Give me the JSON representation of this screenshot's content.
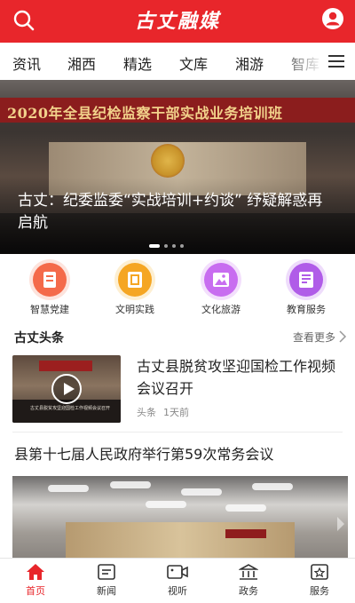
{
  "header": {
    "logo_text": "古丈融媒",
    "search_icon": "search-icon",
    "user_icon": "user-icon"
  },
  "category_nav": {
    "items": [
      "资讯",
      "湘西",
      "精选",
      "文库",
      "湘游",
      "智库"
    ],
    "menu_icon": "menu-icon"
  },
  "banner": {
    "stage_text": "2020年全县纪检监察干部实战业务培训班",
    "title": "古丈：纪委监委“实战培训+约谈” 纾疑解惑再启航"
  },
  "services": [
    {
      "label": "智慧党建",
      "icon": "party-building-icon",
      "color": "#f46a4a"
    },
    {
      "label": "文明实践",
      "icon": "civilization-practice-icon",
      "color": "#f5a623"
    },
    {
      "label": "文化旅游",
      "icon": "culture-tourism-icon",
      "color": "#c86df0"
    },
    {
      "label": "教育服务",
      "icon": "education-service-icon",
      "color": "#b05ce8"
    }
  ],
  "section": {
    "title": "古丈头条",
    "more_label": "查看更多"
  },
  "articles": [
    {
      "title": "古丈县脱贫攻坚迎国检工作视频会议召开",
      "source": "头条",
      "time": "1天前",
      "thumb_caption": "古丈县脱贫攻坚迎国检工作视频会议召开"
    },
    {
      "title": "县第十七届人民政府举行第59次常务会议"
    }
  ],
  "tabbar": {
    "items": [
      {
        "label": "首页",
        "icon": "home-icon",
        "active": true
      },
      {
        "label": "新闻",
        "icon": "news-icon",
        "active": false
      },
      {
        "label": "视听",
        "icon": "video-icon",
        "active": false
      },
      {
        "label": "政务",
        "icon": "government-icon",
        "active": false
      },
      {
        "label": "服务",
        "icon": "service-icon",
        "active": false
      }
    ]
  },
  "colors": {
    "brand_red": "#e8262b"
  }
}
